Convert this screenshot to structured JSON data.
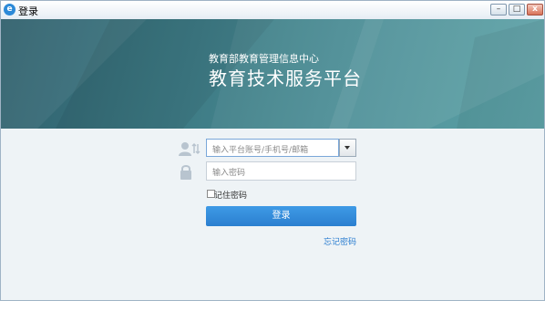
{
  "window": {
    "title": "登录"
  },
  "banner": {
    "subtitle": "教育部教育管理信息中心",
    "title": "教育技术服务平台"
  },
  "form": {
    "account_placeholder": "输入平台账号/手机号/邮箱",
    "password_placeholder": "输入密码",
    "remember_label": "记住密码",
    "login_label": "登录",
    "forgot_label": "忘记密码"
  },
  "colors": {
    "accent": "#2b7fd0",
    "banner": "#3d7a84",
    "link": "#2a7dd0"
  },
  "icons": [
    "app-logo-icon",
    "user-switch-icon",
    "lock-icon",
    "chevron-down-icon",
    "minimize-icon",
    "maximize-icon",
    "close-icon"
  ]
}
